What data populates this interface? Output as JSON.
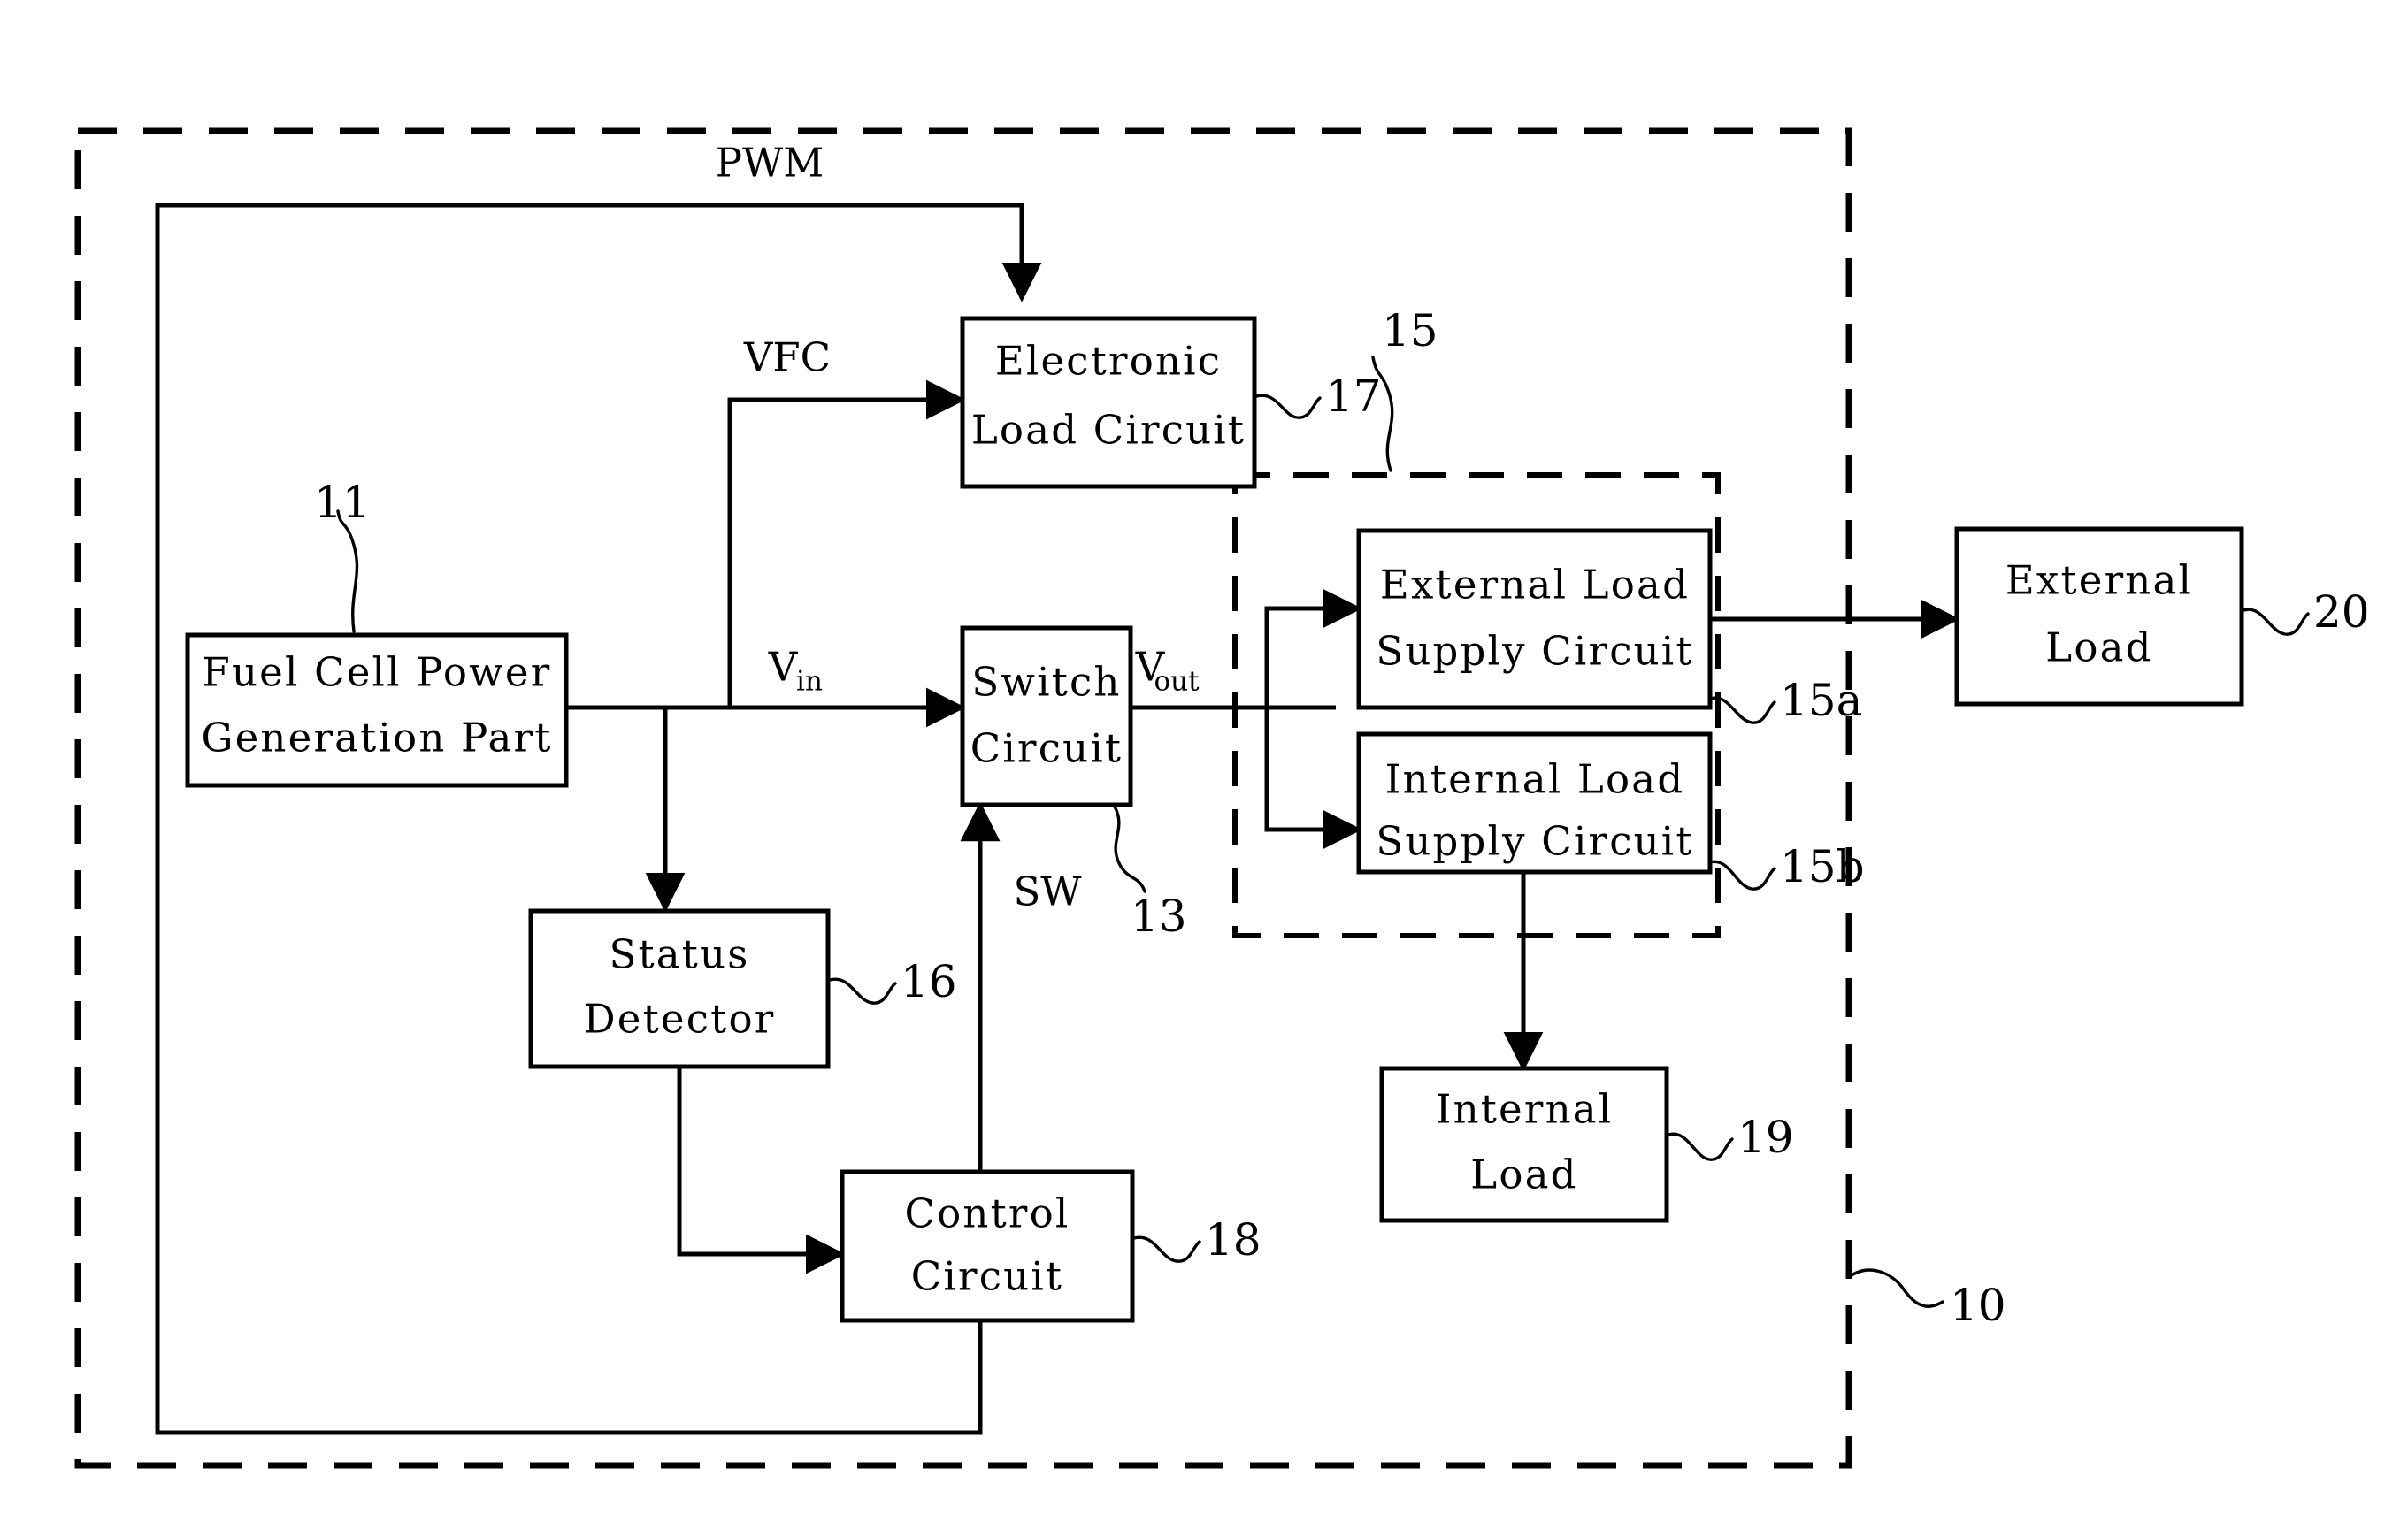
{
  "figure": {
    "type": "patent-block-diagram",
    "background_color": "#ffffff",
    "line_color": "#000000"
  },
  "outer_enclosure": {
    "reference": "10",
    "style": "dashed"
  },
  "group_enclosure": {
    "reference": "15",
    "style": "dashed"
  },
  "blocks": {
    "fuel_cell": {
      "line1": "Fuel Cell Power",
      "line2": "Generation Part",
      "reference": "11"
    },
    "electronic_load": {
      "line1": "Electronic",
      "line2": "Load Circuit",
      "reference": "17"
    },
    "switch_circuit": {
      "line1": "Switch",
      "line2": "Circuit",
      "reference": "13"
    },
    "status_detector": {
      "line1": "Status",
      "line2": "Detector",
      "reference": "16"
    },
    "control_circuit": {
      "line1": "Control",
      "line2": "Circuit",
      "reference": "18"
    },
    "external_load_supply": {
      "line1": "External Load",
      "line2": "Supply Circuit",
      "reference": "15a"
    },
    "internal_load_supply": {
      "line1": "Internal Load",
      "line2": "Supply Circuit",
      "reference": "15b"
    },
    "internal_load": {
      "line1": "Internal",
      "line2": "Load",
      "reference": "19"
    },
    "external_load": {
      "line1": "External",
      "line2": "Load",
      "reference": "20"
    }
  },
  "signals": {
    "pwm": "PWM",
    "vfc": "VFC",
    "vin_base": "V",
    "vin_sub": "in",
    "vout_base": "V",
    "vout_sub": "out",
    "sw": "SW"
  }
}
